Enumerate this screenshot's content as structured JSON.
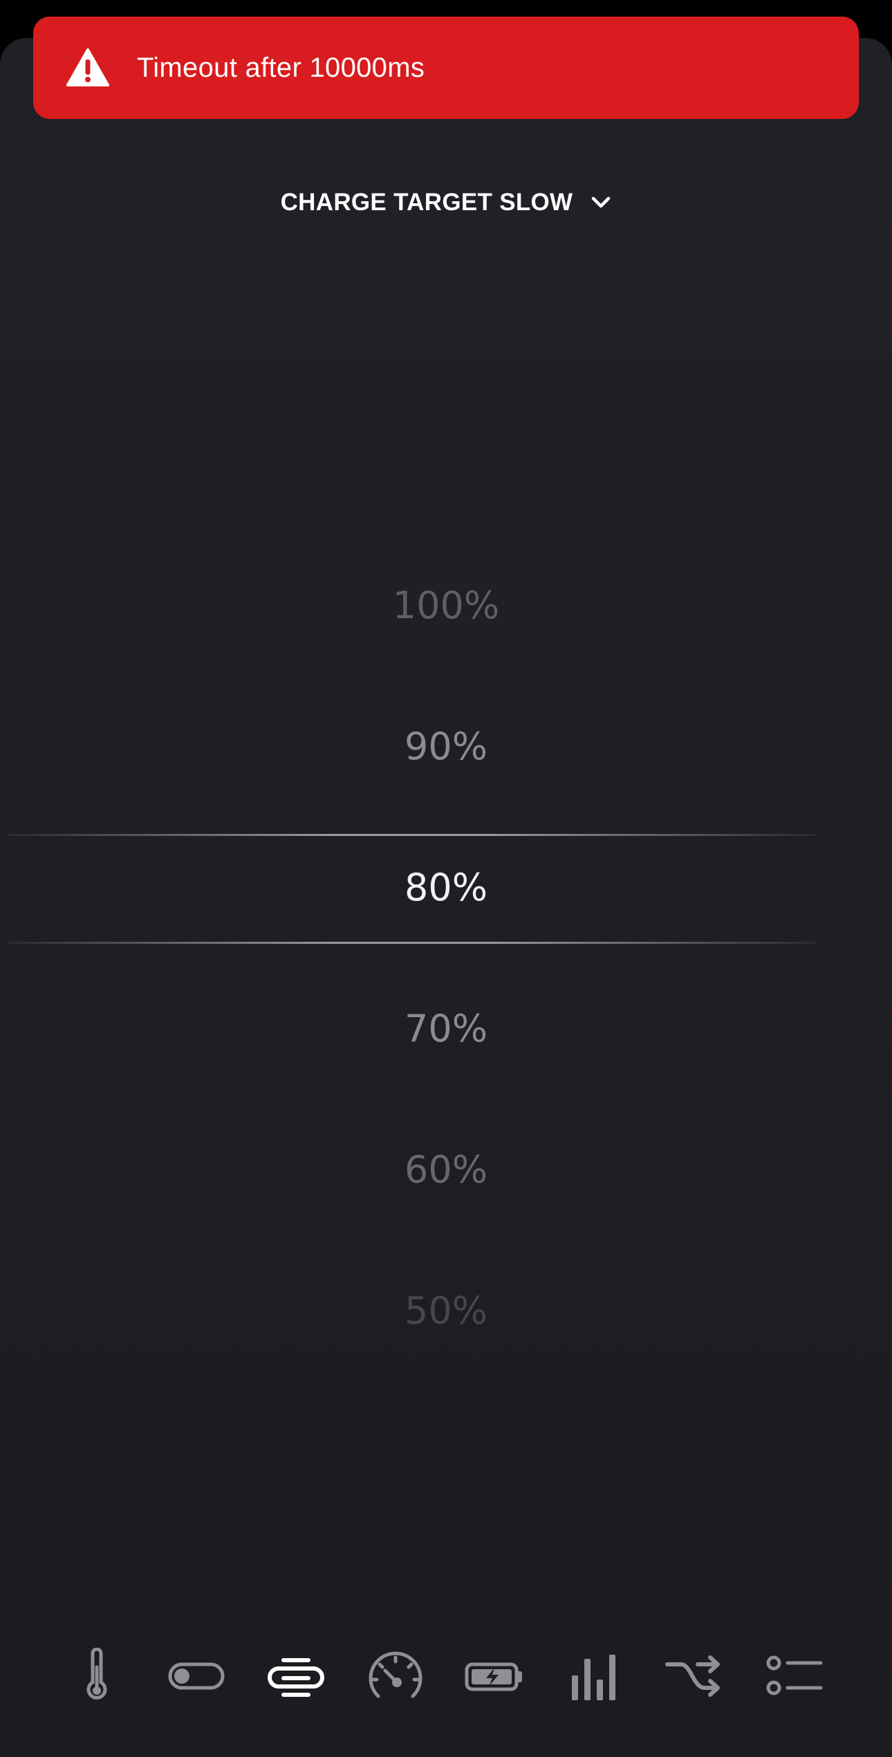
{
  "toast": {
    "message": "Timeout after 10000ms",
    "icon": "warning-icon",
    "color": "#d91c1f"
  },
  "selector": {
    "label": "CHARGE TARGET SLOW",
    "icon": "chevron-down-icon"
  },
  "picker": {
    "options": [
      "100%",
      "90%",
      "80%",
      "70%",
      "60%",
      "50%"
    ],
    "selected": "80%"
  },
  "tabbar": {
    "tabs": [
      {
        "icon": "thermometer-icon",
        "active": false
      },
      {
        "icon": "toggle-icon",
        "active": false
      },
      {
        "icon": "charge-target-icon",
        "active": true
      },
      {
        "icon": "speedometer-icon",
        "active": false
      },
      {
        "icon": "battery-charging-icon",
        "active": false
      },
      {
        "icon": "bar-chart-icon",
        "active": false
      },
      {
        "icon": "shuffle-icon",
        "active": false
      },
      {
        "icon": "list-icon",
        "active": false
      }
    ]
  }
}
